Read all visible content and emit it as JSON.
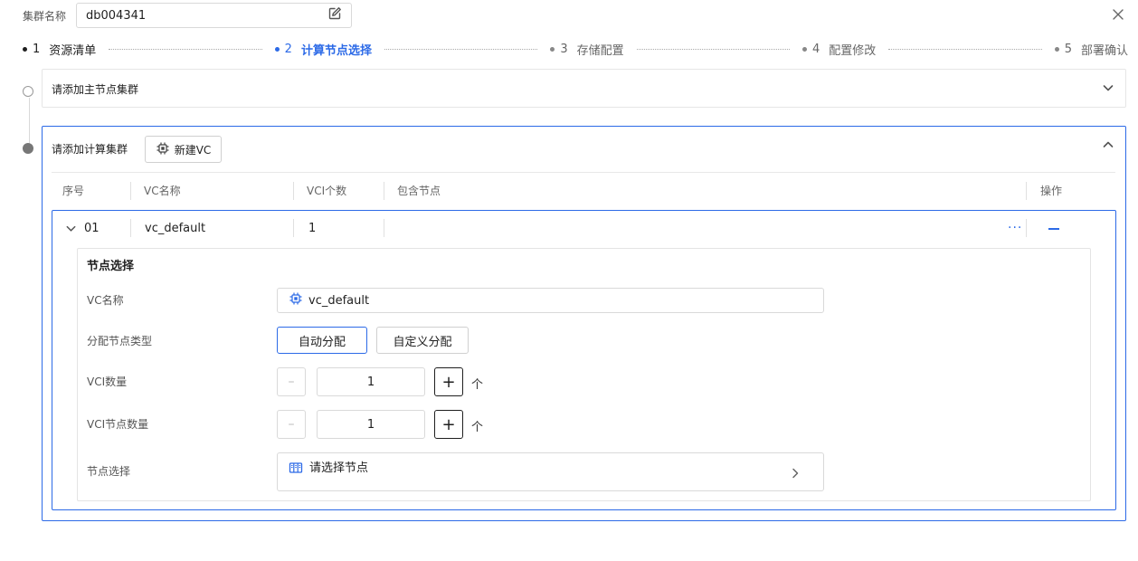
{
  "header": {
    "cluster_label": "集群名称",
    "cluster_name": "db004341"
  },
  "steps": [
    {
      "num": "1",
      "label": "资源清单",
      "state": "done"
    },
    {
      "num": "2",
      "label": "计算节点选择",
      "state": "active"
    },
    {
      "num": "3",
      "label": "存储配置",
      "state": "pending"
    },
    {
      "num": "4",
      "label": "配置修改",
      "state": "pending"
    },
    {
      "num": "5",
      "label": "部署确认",
      "state": "pending"
    }
  ],
  "master_panel": {
    "title": "请添加主节点集群"
  },
  "compute_panel": {
    "title": "请添加计算集群",
    "new_vc_label": "新建VC",
    "columns": [
      "序号",
      "VC名称",
      "VCI个数",
      "包含节点",
      "操作"
    ],
    "rows": [
      {
        "index": "01",
        "vc_name": "vc_default",
        "vci_count": "1",
        "nodes": "",
        "more": "···"
      }
    ],
    "detail": {
      "title": "节点选择",
      "vc_name_label": "VC名称",
      "vc_name_value": "vc_default",
      "alloc_type_label": "分配节点类型",
      "alloc_auto": "自动分配",
      "alloc_custom": "自定义分配",
      "vci_count_label": "VCI数量",
      "vci_count_value": "1",
      "vci_node_count_label": "VCI节点数量",
      "vci_node_count_value": "1",
      "unit": "个",
      "node_select_label": "节点选择",
      "node_select_placeholder": "请选择节点"
    }
  },
  "colors": {
    "accent": "#2c6ae7",
    "border": "#d9d9d9"
  }
}
